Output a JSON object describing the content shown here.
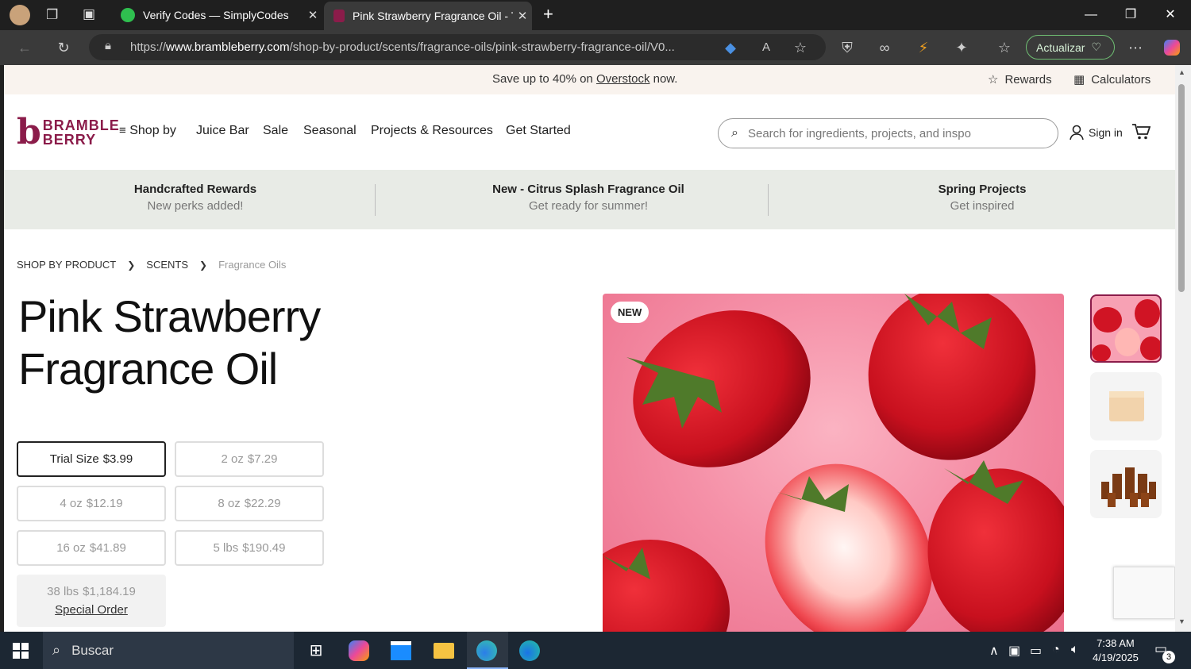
{
  "browser": {
    "tabs": [
      {
        "title": "Verify Codes — SimplyCodes",
        "active": false
      },
      {
        "title": "Pink Strawberry Fragrance Oil - Tr",
        "active": true
      }
    ],
    "url_scheme": "https://",
    "url_host": "www.brambleberry.com",
    "url_path": "/shop-by-product/scents/fragrance-oils/pink-strawberry-fragrance-oil/V0...",
    "update_label": "Actualizar"
  },
  "promo": {
    "prefix": "Save up to 40% on ",
    "link": "Overstock",
    "suffix": " now.",
    "rewards": "Rewards",
    "calculators": "Calculators"
  },
  "header": {
    "logo_b": "b",
    "logo_line1": "BRAMBLE",
    "logo_line2": "BERRY",
    "nav": [
      "Shop by",
      "Juice Bar",
      "Sale",
      "Seasonal",
      "Projects & Resources",
      "Get Started"
    ],
    "search_placeholder": "Search for ingredients, projects, and inspo",
    "signin": "Sign in"
  },
  "announcements": [
    {
      "title": "Handcrafted Rewards",
      "subtitle": "New perks added!"
    },
    {
      "title": "New - Citrus Splash Fragrance Oil",
      "subtitle": "Get ready for summer!"
    },
    {
      "title": "Spring Projects",
      "subtitle": "Get inspired"
    }
  ],
  "breadcrumb": [
    "SHOP BY PRODUCT",
    "SCENTS",
    "Fragrance Oils"
  ],
  "product": {
    "title_line1": "Pink Strawberry",
    "title_line2": "Fragrance Oil",
    "badge": "NEW",
    "sizes": [
      {
        "size": "Trial Size",
        "price": "$3.99",
        "selected": true
      },
      {
        "size": "2 oz",
        "price": "$7.29"
      },
      {
        "size": "4 oz",
        "price": "$12.19"
      },
      {
        "size": "8 oz",
        "price": "$22.29"
      },
      {
        "size": "16 oz",
        "price": "$41.89"
      },
      {
        "size": "5 lbs",
        "price": "$190.49"
      },
      {
        "size": "38 lbs",
        "price": "$1,184.19",
        "note": "Special Order"
      }
    ]
  },
  "taskbar": {
    "search": "Buscar",
    "time": "7:38 AM",
    "date": "4/19/2025",
    "notifications": "3"
  },
  "colors": {
    "brand": "#8b1c4a",
    "promo_bg": "#f9f3ee",
    "announce_bg": "#e8ebe6",
    "update_border": "#6fbf73"
  }
}
